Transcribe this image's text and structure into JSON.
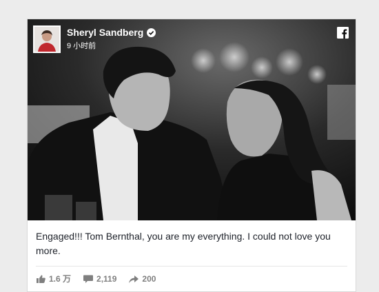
{
  "post": {
    "author": "Sheryl Sandberg",
    "timestamp": "9 小时前",
    "text": "Engaged!!! Tom Bernthal, you are my everything. I could not love you more.",
    "likes": "1.6 万",
    "comments": "2,119",
    "shares": "200"
  },
  "icons": {
    "verified": "verified-badge-icon",
    "platform": "facebook-logo-icon",
    "like": "thumbs-up-icon",
    "comment": "comment-bubble-icon",
    "share": "share-arrow-icon"
  },
  "colors": {
    "stat_gray": "#7f7f7f",
    "text": "#1d2129",
    "background": "#ececec"
  }
}
